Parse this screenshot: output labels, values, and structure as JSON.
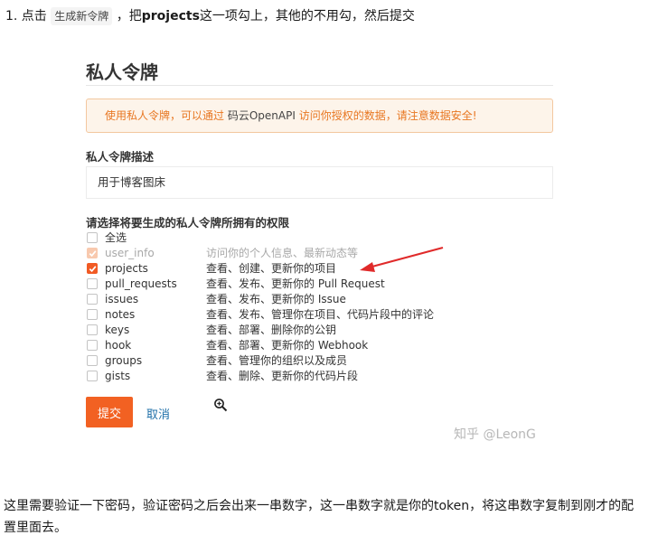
{
  "instruction": {
    "prefix": "1. 点击",
    "chip": "生成新令牌",
    "middle": "，把",
    "keyword": "projects",
    "suffix": "这一项勾上，其他的不用勾，然后提交"
  },
  "form": {
    "title": "私人令牌",
    "alert": {
      "before": "使用私人令牌，可以通过",
      "link": "码云OpenAPI",
      "after": "访问你授权的数据，请注意数据安全!"
    },
    "description_label": "私人令牌描述",
    "description_value": "用于博客图床",
    "permissions_label": "请选择将要生成的私人令牌所拥有的权限",
    "permissions": [
      {
        "name": "全选",
        "desc": "",
        "checked": false,
        "disabled": false
      },
      {
        "name": "user_info",
        "desc": "访问你的个人信息、最新动态等",
        "checked": true,
        "disabled": true
      },
      {
        "name": "projects",
        "desc": "查看、创建、更新你的项目",
        "checked": true,
        "disabled": false
      },
      {
        "name": "pull_requests",
        "desc": "查看、发布、更新你的 Pull Request",
        "checked": false,
        "disabled": false
      },
      {
        "name": "issues",
        "desc": "查看、发布、更新你的 Issue",
        "checked": false,
        "disabled": false
      },
      {
        "name": "notes",
        "desc": "查看、发布、管理你在项目、代码片段中的评论",
        "checked": false,
        "disabled": false
      },
      {
        "name": "keys",
        "desc": "查看、部署、删除你的公钥",
        "checked": false,
        "disabled": false
      },
      {
        "name": "hook",
        "desc": "查看、部署、更新你的 Webhook",
        "checked": false,
        "disabled": false
      },
      {
        "name": "groups",
        "desc": "查看、管理你的组织以及成员",
        "checked": false,
        "disabled": false
      },
      {
        "name": "gists",
        "desc": "查看、删除、更新你的代码片段",
        "checked": false,
        "disabled": false
      }
    ],
    "submit_label": "提交",
    "cancel_label": "取消"
  },
  "watermark": "知乎 @LeonG",
  "note": "这里需要验证一下密码，验证密码之后会出来一串数字，这一串数字就是你的token，将这串数字复制到刚才的配置里面去。",
  "colors": {
    "accent": "#f26122",
    "alert_bg": "#fdf4ea",
    "alert_text": "#e87722",
    "annotation_arrow": "#e02a2a",
    "link": "#1e6fa8"
  },
  "icons": {
    "zoom": "zoom-in-icon",
    "checkmark": "check-icon"
  }
}
